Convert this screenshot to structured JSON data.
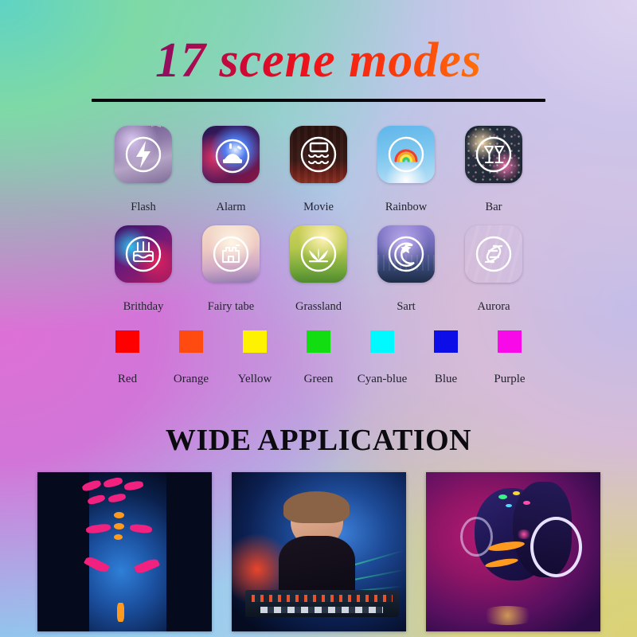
{
  "page": {
    "title": "17 scene modes",
    "subtitle": "WIDE APPLICATION"
  },
  "scene_modes": {
    "row1": [
      {
        "label": "Flash",
        "icon": "lightning-bolt-icon",
        "scene": "thunderstorm"
      },
      {
        "label": "Alarm",
        "icon": "police-siren-icon",
        "scene": "police-lights"
      },
      {
        "label": "Movie",
        "icon": "cinema-seats-icon",
        "scene": "theater-curtain"
      },
      {
        "label": "Rainbow",
        "icon": "rainbow-arc-icon",
        "scene": "sky-rainbow"
      },
      {
        "label": "Bar",
        "icon": "cocktail-glasses-icon",
        "scene": "party-crowd"
      }
    ],
    "row2": [
      {
        "label": "Brithday",
        "icon": "birthday-cake-icon",
        "scene": "neon-party"
      },
      {
        "label": "Fairy tabe",
        "icon": "castle-icon",
        "scene": "fairytale-castle"
      },
      {
        "label": "Grassland",
        "icon": "grass-icon",
        "scene": "green-field"
      },
      {
        "label": "Sart",
        "icon": "moon-star-icon",
        "scene": "night-city"
      },
      {
        "label": "Aurora",
        "icon": "aurora-swirl-icon",
        "scene": "aurora-borealis"
      }
    ]
  },
  "colors": [
    {
      "label": "Red",
      "hex": "#FF0000"
    },
    {
      "label": "Orange",
      "hex": "#FF4A10"
    },
    {
      "label": "Yellow",
      "hex": "#FFF200"
    },
    {
      "label": "Green",
      "hex": "#11DD11"
    },
    {
      "label": "Cyan-blue",
      "hex": "#00F8FF"
    },
    {
      "label": "Blue",
      "hex": "#0D0DE8"
    },
    {
      "label": "Purple",
      "hex": "#F80AE8"
    }
  ],
  "photos": [
    {
      "name": "uv-face-paint-woman",
      "caption": ""
    },
    {
      "name": "female-dj-stage-lights",
      "caption": ""
    },
    {
      "name": "neon-makeup-headphones",
      "caption": ""
    }
  ],
  "background": {
    "top_left": "#79d2c0",
    "top_right": "#ddd3ef",
    "mid_left": "#dd70d6",
    "bottom_left": "#8ec9ef",
    "bottom_right": "#dbd277"
  }
}
